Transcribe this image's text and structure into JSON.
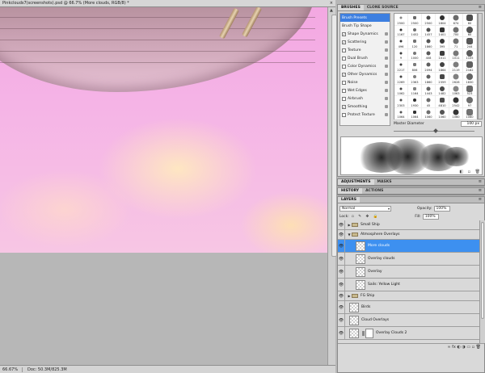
{
  "document": {
    "tab_title": "Pinkclouds7(screenshots).psd @ 66.7% (More clouds, RGB/8) *",
    "close_glyph": "×"
  },
  "status_bar": {
    "zoom": "66.67%",
    "doc_size": "Doc: 50.3M/825.3M"
  },
  "brushes_panel": {
    "tabs": [
      "BRUSHES",
      "CLONE SOURCE"
    ],
    "menu_glyph": "≡",
    "settings": [
      {
        "label": "Brush Presets",
        "checkbox": false,
        "selected": true
      },
      {
        "label": "Brush Tip Shape",
        "checkbox": false,
        "selected": false
      },
      {
        "label": "Shape Dynamics",
        "checkbox": true,
        "checked": true
      },
      {
        "label": "Scattering",
        "checkbox": true,
        "checked": true
      },
      {
        "label": "Texture",
        "checkbox": true,
        "checked": false
      },
      {
        "label": "Dual Brush",
        "checkbox": true,
        "checked": false
      },
      {
        "label": "Color Dynamics",
        "checkbox": true,
        "checked": false
      },
      {
        "label": "Other Dynamics",
        "checkbox": true,
        "checked": true
      },
      {
        "label": "Noise",
        "checkbox": true,
        "checked": false
      },
      {
        "label": "Wet Edges",
        "checkbox": true,
        "checked": false
      },
      {
        "label": "Airbrush",
        "checkbox": true,
        "checked": false
      },
      {
        "label": "Smoothing",
        "checkbox": true,
        "checked": true
      },
      {
        "label": "Protect Texture",
        "checkbox": true,
        "checked": false
      }
    ],
    "preset_sizes": [
      "2500",
      "2500",
      "2500",
      "1804",
      "674",
      "60",
      "1167",
      "1452",
      "1457",
      "1401",
      "700",
      "60",
      "496",
      "120",
      "1860",
      "395",
      "71",
      "244",
      "9",
      "1000",
      "408",
      "1011",
      "1011",
      "1105",
      "2217",
      "806",
      "2094",
      "1864",
      "2119",
      "2182",
      "2269",
      "2363",
      "1860",
      "2359",
      "2628",
      "1830",
      "1062",
      "1164",
      "1443",
      "1482",
      "1063",
      "523",
      "2303",
      "1930",
      "45",
      "4810",
      "2542",
      "97",
      "1064",
      "1064",
      "1060",
      "1060",
      "1060",
      "1060"
    ],
    "master_diameter_label": "Master Diameter",
    "master_diameter_value": "100 px",
    "footer_glyphs": "◧ ▫ 🗑"
  },
  "adjustments_panel": {
    "tabs": [
      "ADJUSTMENTS",
      "MASKS"
    ],
    "menu_glyph": "≡"
  },
  "history_panel": {
    "tabs": [
      "HISTORY",
      "ACTIONS"
    ],
    "menu_glyph": "≡"
  },
  "layers_panel": {
    "tabs": [
      "LAYERS"
    ],
    "menu_glyph": "≡",
    "blend_mode": "Normal",
    "opacity_label": "Opacity:",
    "opacity_value": "100%",
    "lock_label": "Lock:",
    "lock_glyphs": "▫ ✎ ✥ 🔒",
    "fill_label": "Fill:",
    "fill_value": "100%",
    "layers": [
      {
        "name": "Small Ship",
        "type": "group",
        "indent": 0,
        "expanded": false,
        "visible": true,
        "selected": false
      },
      {
        "name": "Atmosphere Overlays",
        "type": "group",
        "indent": 0,
        "expanded": true,
        "visible": true,
        "selected": false
      },
      {
        "name": "More clouds",
        "type": "layer",
        "indent": 1,
        "visible": true,
        "selected": true,
        "mask": false
      },
      {
        "name": "Overlay clouds",
        "type": "layer",
        "indent": 1,
        "visible": true,
        "selected": false,
        "mask": false
      },
      {
        "name": "Overlay",
        "type": "layer",
        "indent": 1,
        "visible": true,
        "selected": false,
        "mask": false
      },
      {
        "name": "Sails: Yellow Light",
        "type": "layer",
        "indent": 1,
        "visible": true,
        "selected": false,
        "mask": false
      },
      {
        "name": "FG Ship",
        "type": "group",
        "indent": 0,
        "expanded": false,
        "visible": true,
        "selected": false
      },
      {
        "name": "Birds",
        "type": "layer",
        "indent": 0,
        "visible": true,
        "selected": false,
        "mask": false
      },
      {
        "name": "Cloud Overlays",
        "type": "layer",
        "indent": 0,
        "visible": true,
        "selected": false,
        "mask": false
      },
      {
        "name": "Overlay Clouds 2",
        "type": "layer",
        "indent": 0,
        "visible": true,
        "selected": false,
        "mask": true
      }
    ],
    "footer_glyphs": "∞ fx ◐ ◑ ▭ ▫ 🗑"
  },
  "icons": {
    "eye": "👁",
    "expanded": "▼",
    "collapsed": "▶"
  }
}
